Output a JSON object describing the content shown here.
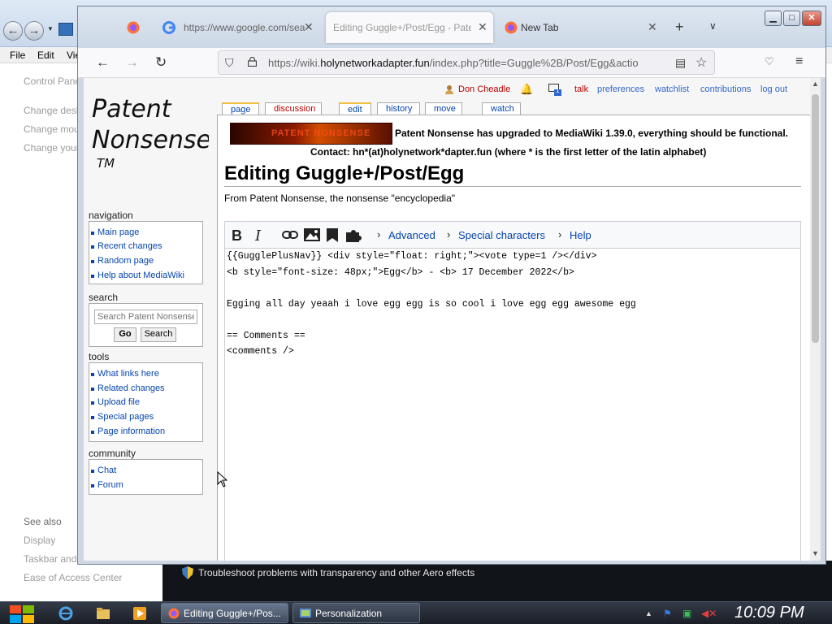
{
  "control_panel": {
    "menu": [
      "File",
      "Edit",
      "Vie"
    ],
    "side_links": [
      "Control Pane",
      "Change desk",
      "Change mou",
      "Change your"
    ],
    "see_also_heading": "See also",
    "see_also": [
      "Display",
      "Taskbar and",
      "Ease of Access Center"
    ],
    "trouble_text": "Troubleshoot problems with transparency and other Aero effects"
  },
  "browser": {
    "tabs": [
      {
        "title": "",
        "icon": "firefox-icon"
      },
      {
        "title": "https://www.google.com/sea",
        "icon": "google-icon"
      },
      {
        "title": "Editing Guggle+/Post/Egg - Pate",
        "icon": "",
        "active": true
      },
      {
        "title": "New Tab",
        "icon": "firefox-icon"
      }
    ],
    "url_prefix": "https://wiki.",
    "url_domain": "holynetworkadapter.fun",
    "url_rest": "/index.php?title=Guggle%2B/Post/Egg&actio"
  },
  "wiki": {
    "personal": {
      "user": "Don Cheadle",
      "notifications_count": "1",
      "talk": "talk",
      "preferences": "preferences",
      "watchlist": "watchlist",
      "contributions": "contributions",
      "logout": "log out"
    },
    "page_tabs": {
      "page": "page",
      "discussion": "discussion",
      "edit": "edit",
      "history": "history",
      "move": "move",
      "watch": "watch"
    },
    "logo_text": [
      "Patent",
      "Nonsense",
      "TM"
    ],
    "banner_text": "PATENT NONSENSE",
    "sitenotice_1": "Patent Nonsense has upgraded to MediaWiki 1.39.0, everything should be functional.",
    "sitenotice_2": "Contact: hn*(at)holynetwork*dapter.fun (where * is the first letter of the latin alphabet)",
    "heading": "Editing Guggle+/Post/Egg",
    "site_sub": "From Patent Nonsense, the nonsense \"encyclopedia\"",
    "toolbar": {
      "bold": "B",
      "italic": "I",
      "advanced": "Advanced",
      "special": "Special characters",
      "help": "Help"
    },
    "text_lines": [
      "{{GugglePlusNav}} <div style=\"float: right;\"><vote type=1 /></div>",
      "<b style=\"font-size: 48px;\">Egg</b> - <b> 17 December 2022</b>",
      "",
      "Egging all day yeaah i love egg egg is so cool i love egg egg awesome egg",
      "",
      "== Comments ==",
      "<comments />"
    ],
    "sidebar": {
      "navigation_heading": "navigation",
      "navigation": [
        "Main page",
        "Recent changes",
        "Random page",
        "Help about MediaWiki"
      ],
      "search_heading": "search",
      "search_placeholder": "Search Patent Nonsense",
      "go": "Go",
      "search": "Search",
      "tools_heading": "tools",
      "tools": [
        "What links here",
        "Related changes",
        "Upload file",
        "Special pages",
        "Page information"
      ],
      "community_heading": "community",
      "community": [
        "Chat",
        "Forum"
      ]
    }
  },
  "taskbar": {
    "tasks": [
      {
        "label": "Editing Guggle+/Pos...",
        "active": true
      },
      {
        "label": "Personalization",
        "active": false
      }
    ],
    "clock": "10:09 PM"
  },
  "colors": {
    "link": "#0645ad",
    "redlink": "#ba0000",
    "personal_link": "#3366cc",
    "taskbar": "#1a1e26"
  }
}
